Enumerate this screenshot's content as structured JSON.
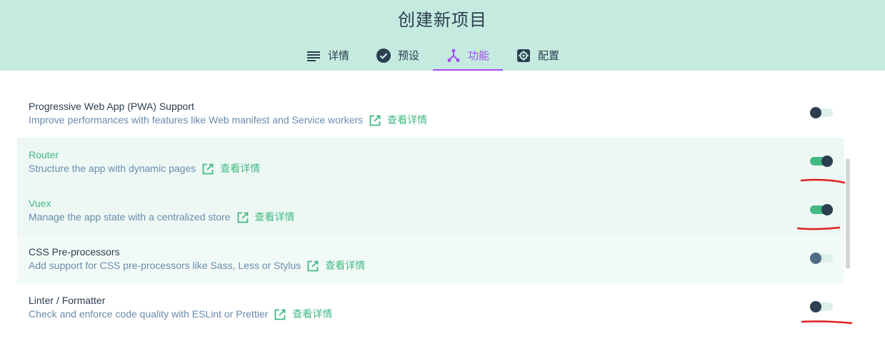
{
  "header": {
    "title": "创建新项目"
  },
  "tabs": [
    {
      "label": "详情",
      "icon": "list-icon"
    },
    {
      "label": "预设",
      "icon": "check-circle-icon"
    },
    {
      "label": "功能",
      "icon": "fork-icon",
      "active": true
    },
    {
      "label": "配置",
      "icon": "gear-icon"
    }
  ],
  "features": [
    {
      "name": "Progressive Web App (PWA) Support",
      "desc": "Improve performances with features like Web manifest and Service workers",
      "more": "查看详情",
      "enabled": false
    },
    {
      "name": "Router",
      "desc": "Structure the app with dynamic pages",
      "more": "查看详情",
      "enabled": true
    },
    {
      "name": "Vuex",
      "desc": "Manage the app state with a centralized store",
      "more": "查看详情",
      "enabled": true
    },
    {
      "name": "CSS Pre-processors",
      "desc": "Add support for CSS pre-processors like Sass, Less or Stylus",
      "more": "查看详情",
      "enabled": false
    },
    {
      "name": "Linter / Formatter",
      "desc": "Check and enforce code quality with ESLint or Prettier",
      "more": "查看详情",
      "enabled": false
    }
  ],
  "colors": {
    "accent": "#42b983",
    "tab_active": "#a44cf1",
    "header_bg": "#c5eadf",
    "annotation": "#e02020"
  }
}
